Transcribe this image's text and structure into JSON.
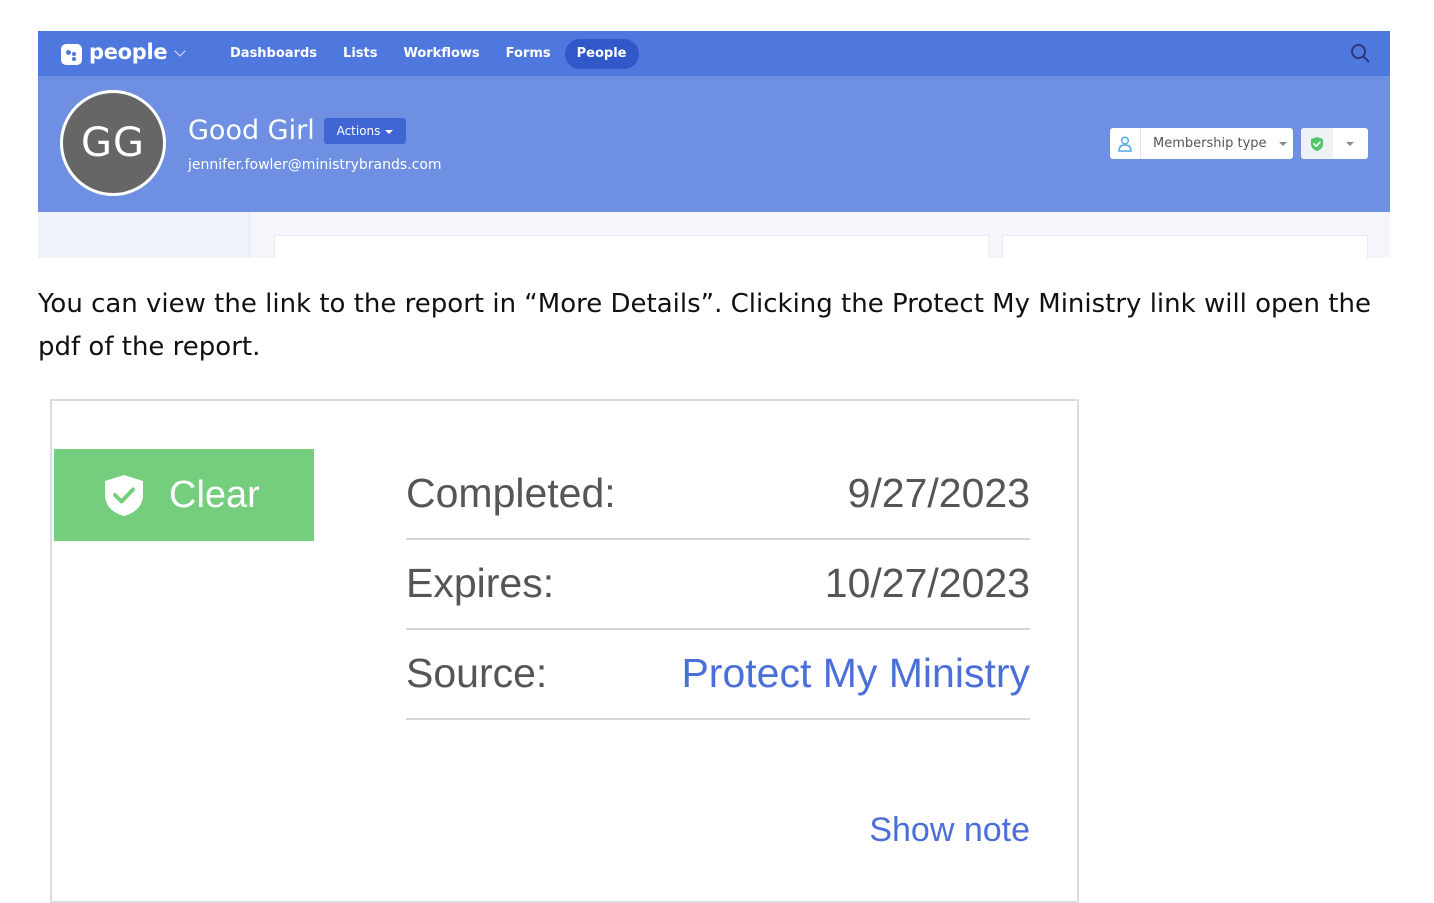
{
  "app": {
    "brand": "people",
    "nav": [
      {
        "label": "Dashboards",
        "active": false
      },
      {
        "label": "Lists",
        "active": false
      },
      {
        "label": "Workflows",
        "active": false
      },
      {
        "label": "Forms",
        "active": false
      },
      {
        "label": "People",
        "active": true
      }
    ],
    "profile": {
      "initials": "GG",
      "name": "Good Girl",
      "actions_label": "Actions",
      "email": "jennifer.fowler@ministrybrands.com",
      "membership_label": "Membership type"
    },
    "colors": {
      "navbar": "#4f78de",
      "header": "#6e8fe2",
      "active_tab": "#3058c8",
      "avatar": "#666666"
    }
  },
  "caption": "You can view the link to the report in “More Details”. Clicking the Protect My Ministry link will open the pdf of the report.",
  "background_check": {
    "status": "Clear",
    "status_color": "#75cd7e",
    "rows": [
      {
        "label": "Completed:",
        "value": "9/27/2023",
        "is_link": false
      },
      {
        "label": "Expires:",
        "value": "10/27/2023",
        "is_link": false
      },
      {
        "label": "Source:",
        "value": "Protect My Ministry",
        "is_link": true
      }
    ],
    "show_note_label": "Show note",
    "link_color": "#4a6fd8"
  }
}
